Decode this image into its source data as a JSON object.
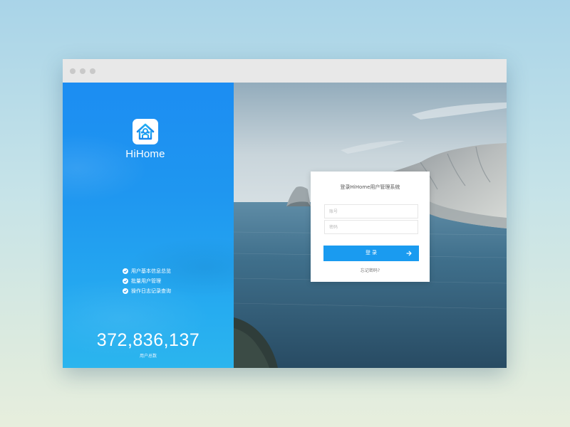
{
  "window": {
    "controls": [
      "close-dot",
      "minimize-dot",
      "maximize-dot"
    ]
  },
  "brand": {
    "name": "HiHome",
    "logo_icon": "house-icon"
  },
  "features": [
    {
      "icon": "check-circle-icon",
      "label": "用户基本信息总览"
    },
    {
      "icon": "check-circle-icon",
      "label": "批量用户管理"
    },
    {
      "icon": "check-circle-icon",
      "label": "操作日志记录查询"
    }
  ],
  "stats": {
    "user_count": "372,836,137",
    "user_count_label": "用户总数"
  },
  "login": {
    "title": "登录HiHome用户管理系统",
    "username_placeholder": "账号",
    "password_placeholder": "密码",
    "submit_label": "登 录",
    "submit_icon": "arrow-right-icon",
    "forgot_label": "忘记密码?"
  },
  "colors": {
    "panel_blue_top": "#1c8df2",
    "panel_blue_bottom": "#2bb5ee",
    "button_blue": "#1a9bf0",
    "titlebar": "#e8e8e8"
  }
}
